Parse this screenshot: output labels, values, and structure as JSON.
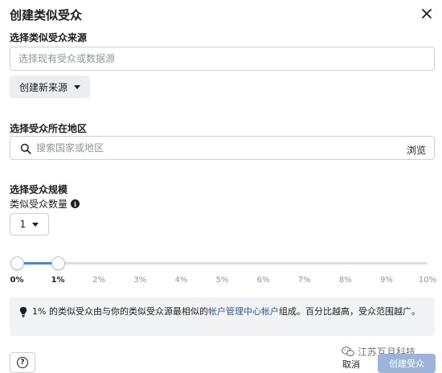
{
  "dialog": {
    "title": "创建类似受众"
  },
  "source": {
    "label": "选择类似受众来源",
    "placeholder": "选择现有受众或数据源",
    "create_button": "创建新来源"
  },
  "location": {
    "label": "选择受众所在地区",
    "placeholder": "搜索国家或地区",
    "browse": "浏览"
  },
  "size": {
    "label": "选择受众规模",
    "count_label": "类似受众数量",
    "count_value": "1",
    "slider": {
      "ticks": [
        "0%",
        "1%",
        "2%",
        "3%",
        "4%",
        "5%",
        "6%",
        "7%",
        "8%",
        "9%",
        "10%"
      ],
      "range_min_percent": 0,
      "range_max_percent": 1
    }
  },
  "info": {
    "text_before": "1% 的类似受众由与你的类似受众源最相似的",
    "link": "帐户管理中心帐户",
    "text_after": "组成。百分比越高，受众范围越广。"
  },
  "footer": {
    "help": "?",
    "cancel": "取消",
    "create": "创建受众",
    "watermark": "江苏互旦科技"
  },
  "colors": {
    "accent": "#4f81e2",
    "link": "#385898",
    "disabled_primary": "#9cb4d8"
  }
}
